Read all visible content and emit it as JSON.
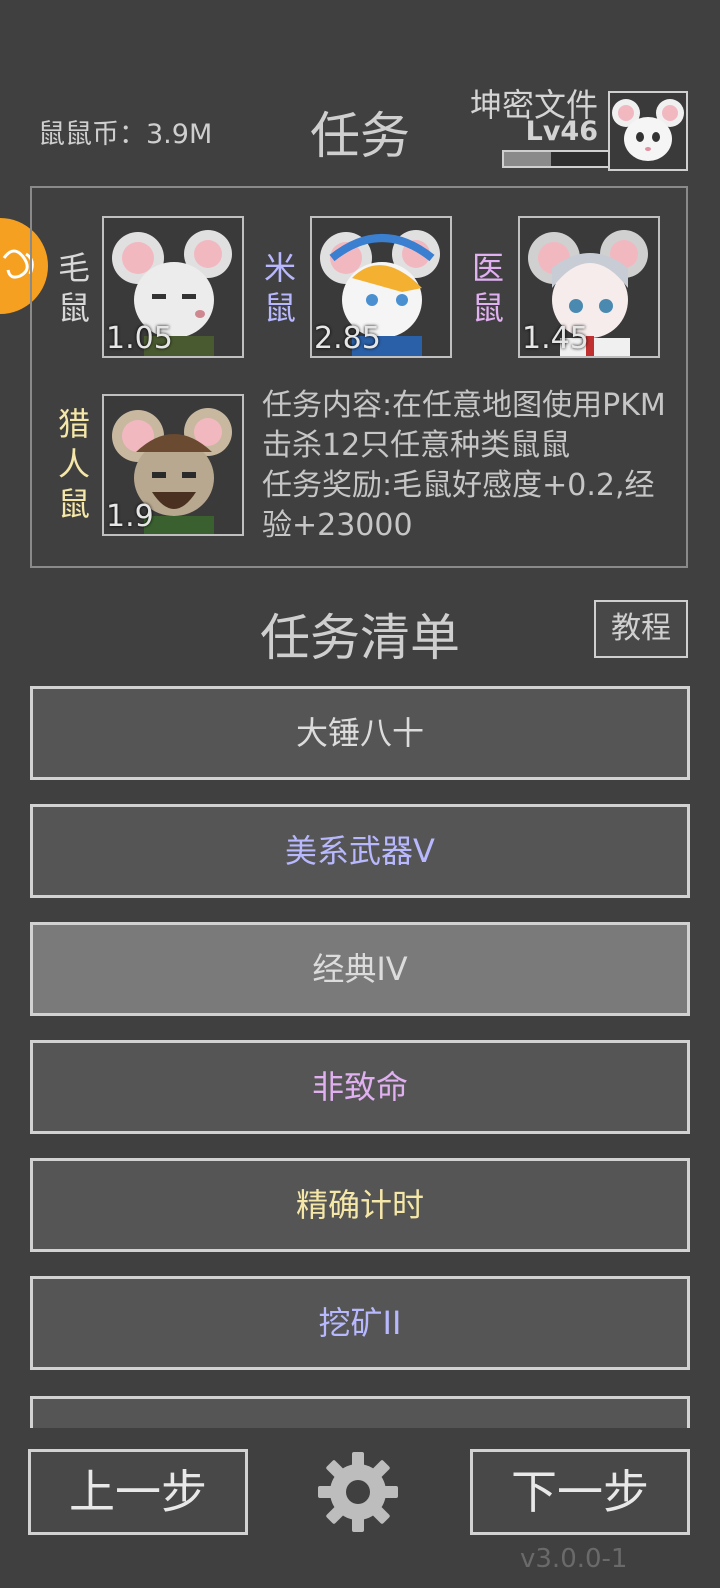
{
  "header": {
    "coins": "鼠鼠币：3.9M",
    "title": "任务",
    "player_name": "坤密文件",
    "player_level": "Lv46",
    "xp_progress": 0.45
  },
  "mission_panel": {
    "mice": [
      {
        "name": "毛鼠",
        "value": "1.05",
        "color": "#d8d8d8"
      },
      {
        "name": "米鼠",
        "value": "2.85",
        "color": "#b8b8ff"
      },
      {
        "name": "医鼠",
        "value": "1.45",
        "color": "#e0b0f0"
      },
      {
        "name": "猎人鼠",
        "value": "1.9",
        "color": "#f5e7a8"
      }
    ],
    "content": "任务内容:在任意地图使用PKM击杀12只任意种类鼠鼠",
    "reward": "任务奖励:毛鼠好感度+0.2,经验+23000"
  },
  "list": {
    "title": "任务清单",
    "tutorial_label": "教程",
    "missions": [
      {
        "label": "大锤八十",
        "color": "#dcdcdc",
        "selected": false
      },
      {
        "label": "美系武器V",
        "color": "#b8b8ff",
        "selected": false
      },
      {
        "label": "经典IV",
        "color": "#dcdcdc",
        "selected": true
      },
      {
        "label": "非致命",
        "color": "#e0b0f0",
        "selected": false
      },
      {
        "label": "精确计时",
        "color": "#f5e7a8",
        "selected": false
      },
      {
        "label": "挖矿II",
        "color": "#b8b8ff",
        "selected": false
      }
    ]
  },
  "footer": {
    "prev_label": "上一步",
    "next_label": "下一步",
    "settings_icon": "gear-icon",
    "version": "v3.0.0-1"
  },
  "colors": {
    "background": "#404040",
    "accent": "#f5a020"
  }
}
